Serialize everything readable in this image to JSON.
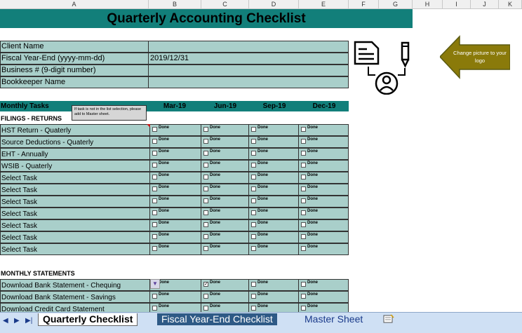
{
  "columns": [
    "A",
    "B",
    "C",
    "D",
    "E",
    "F",
    "G",
    "H",
    "I",
    "J",
    "K"
  ],
  "sheet": {
    "title": "Quarterly Accounting Checklist",
    "client_info": [
      {
        "label": "Client Name",
        "value": ""
      },
      {
        "label": "Fiscal Year-End (yyyy-mm-dd)",
        "value": "2019/12/31"
      },
      {
        "label": "Business # (9-digit number)",
        "value": ""
      },
      {
        "label": "Bookkeeper Name",
        "value": ""
      }
    ],
    "monthly_tasks_label": "Monthly Tasks",
    "months": [
      "Mar-19",
      "Jun-19",
      "Sep-19",
      "Dec-19"
    ],
    "comment": "If task is not in the list selection, please add to Master sheet.",
    "sections": {
      "filings": {
        "title": "FILINGS - RETURNS",
        "tasks": [
          {
            "name": "HST Return - Quaterly",
            "done": [
              false,
              false,
              false,
              false
            ]
          },
          {
            "name": "Source Deductions - Quaterly",
            "done": [
              false,
              false,
              false,
              false
            ]
          },
          {
            "name": "EHT - Annually",
            "done": [
              false,
              false,
              false,
              false
            ]
          },
          {
            "name": "WSIB - Quaterly",
            "done": [
              false,
              false,
              false,
              false
            ]
          },
          {
            "name": "Select Task",
            "done": [
              false,
              false,
              false,
              false
            ]
          },
          {
            "name": "Select Task",
            "done": [
              false,
              false,
              false,
              false
            ]
          },
          {
            "name": "Select Task",
            "done": [
              false,
              false,
              false,
              false
            ]
          },
          {
            "name": "Select Task",
            "done": [
              false,
              false,
              false,
              false
            ]
          },
          {
            "name": "Select Task",
            "done": [
              false,
              false,
              false,
              false
            ]
          },
          {
            "name": "Select Task",
            "done": [
              false,
              false,
              false,
              false
            ]
          },
          {
            "name": "Select Task",
            "done": [
              false,
              false,
              false,
              false
            ]
          }
        ]
      },
      "statements": {
        "title": "MONTHLY STATEMENTS",
        "tasks": [
          {
            "name": "Download Bank Statement - Chequing",
            "done": [
              false,
              true,
              false,
              false
            ]
          },
          {
            "name": "Download Bank Statement - Savings",
            "done": [
              false,
              false,
              false,
              false
            ]
          },
          {
            "name": "Download Credit Card Statement",
            "done": [
              false,
              false,
              false,
              false
            ]
          }
        ]
      }
    },
    "checkbox_label": "Done",
    "logo_callout": "Change picture to your logo"
  },
  "tabs": [
    {
      "label": "Quarterly Checklist",
      "active": true
    },
    {
      "label": "Fiscal Year-End Checklist",
      "active": false
    },
    {
      "label": "Master Sheet",
      "active": false
    }
  ],
  "colors": {
    "header_teal": "#127f7a",
    "cell_fill": "#a9cfca",
    "callout_olive": "#8a7a0a"
  }
}
